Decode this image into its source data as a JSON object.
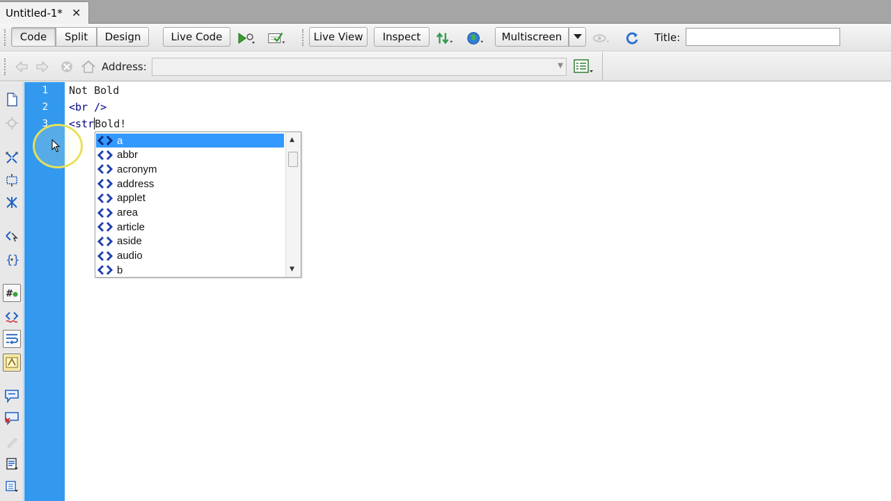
{
  "tab": {
    "title": "Untitled-1*",
    "close_glyph": "✕"
  },
  "toolbar": {
    "code_label": "Code",
    "split_label": "Split",
    "design_label": "Design",
    "live_code_label": "Live Code",
    "live_view_label": "Live View",
    "inspect_label": "Inspect",
    "multiscreen_label": "Multiscreen",
    "title_label": "Title:",
    "title_value": ""
  },
  "navbar": {
    "address_label": "Address:",
    "address_value": ""
  },
  "editor": {
    "line_numbers": [
      "1",
      "2",
      "3"
    ],
    "lines": {
      "line1": "Not Bold",
      "line2": "<br />",
      "line3_before": "<str",
      "line3_after": "Bold!"
    }
  },
  "code_hints": {
    "selected_index": 0,
    "items": [
      "a",
      "abbr",
      "acronym",
      "address",
      "applet",
      "area",
      "article",
      "aside",
      "audio",
      "b"
    ]
  },
  "colors": {
    "gutter": "#3399ee",
    "selection": "#3399ff",
    "tag_icon": "#1f3fae",
    "cursor_ring": "#e8e05a"
  }
}
